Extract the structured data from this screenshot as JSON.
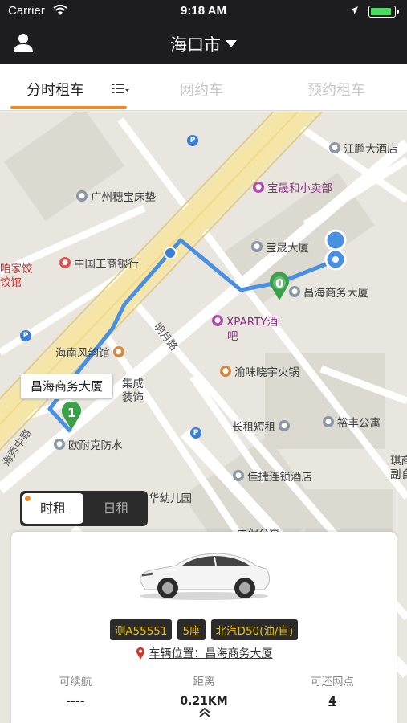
{
  "status_bar": {
    "carrier": "Carrier",
    "time": "9:18 AM"
  },
  "navbar": {
    "city": "海口市"
  },
  "tabs": [
    {
      "label": "分时租车",
      "active": true
    },
    {
      "label": "网约车",
      "active": false
    },
    {
      "label": "预约租车",
      "active": false
    }
  ],
  "map": {
    "pois": [
      "江鹏大酒店",
      "宝晟和小卖部",
      "广州穗宝床垫",
      "宝晟大厦",
      "中国工商银行",
      "昌海商务大厦",
      "XPARTY酒",
      "吧",
      "海南风韵馆",
      "渝味晓宇火锅",
      "集成",
      "装饰",
      "欧耐克防水",
      "长租短租",
      "裕丰公寓",
      "佳捷连锁酒店",
      "华幼儿园",
      "中保公寓",
      "琪商",
      "副食",
      "咱家饺",
      "饺馆"
    ],
    "roads": [
      "明月路",
      "海秀中路"
    ],
    "markers": [
      "0",
      "1"
    ],
    "callout": "昌海商务大厦"
  },
  "rent_toggle": {
    "hourly": "时租",
    "daily": "日租",
    "selected": "时租"
  },
  "vehicle": {
    "plate": "测A55551",
    "seats": "5座",
    "model": "北汽D50(油/自)",
    "location_label": "车辆位置：",
    "location_value": "昌海商务大厦",
    "stats": [
      {
        "label": "可续航",
        "value": "----"
      },
      {
        "label": "距离",
        "value": "0.21KM"
      },
      {
        "label": "可还网点",
        "value": "4"
      }
    ]
  },
  "colors": {
    "accent": "#f08a24",
    "route": "#4a90e2",
    "marker": "#3aa04a",
    "tag_text": "#f2c200"
  }
}
